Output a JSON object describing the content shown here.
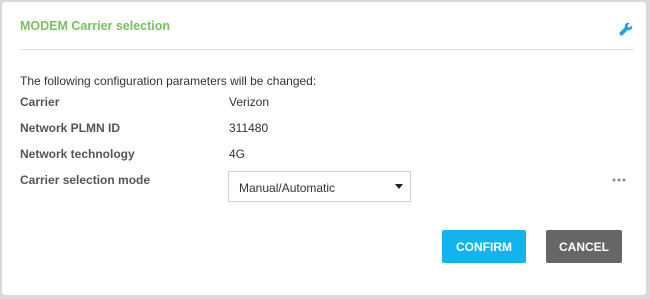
{
  "dialog": {
    "title": "MODEM Carrier selection",
    "settings_icon": "wrench-icon",
    "accent_color": "#79c05f",
    "intro": "The following configuration parameters will be changed:",
    "fields": [
      {
        "label": "Carrier",
        "value": "Verizon"
      },
      {
        "label": "Network PLMN ID",
        "value": "311480"
      },
      {
        "label": "Network technology",
        "value": "4G"
      }
    ],
    "mode": {
      "label": "Carrier selection mode",
      "selected": "Manual/Automatic"
    },
    "more_icon": "more-options-icon"
  },
  "buttons": {
    "confirm": "CONFIRM",
    "cancel": "CANCEL",
    "confirm_color": "#12b4f0",
    "cancel_color": "#666666"
  }
}
